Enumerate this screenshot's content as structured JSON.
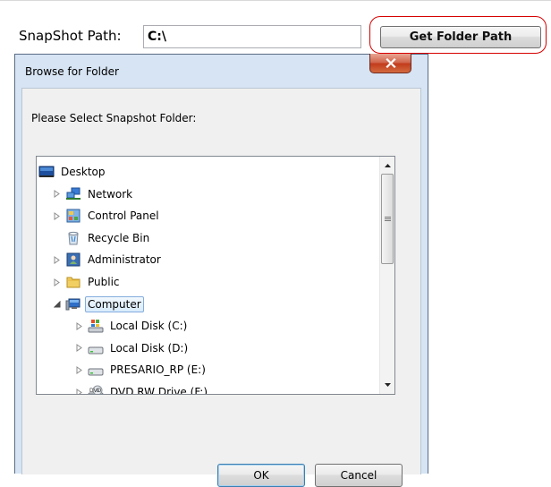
{
  "form": {
    "snapshot_label": "SnapShot Path:",
    "snapshot_value": "C:\\",
    "get_folder_button": "Get Folder Path"
  },
  "dialog": {
    "title": "Browse for Folder",
    "prompt": "Please Select Snapshot Folder:",
    "ok_label": "OK",
    "cancel_label": "Cancel",
    "tree": [
      {
        "label": "Desktop",
        "icon": "desktop-icon",
        "expander": "none"
      },
      {
        "label": "Network",
        "icon": "network-icon",
        "expander": "collapsed"
      },
      {
        "label": "Control Panel",
        "icon": "control-panel-icon",
        "expander": "collapsed"
      },
      {
        "label": "Recycle Bin",
        "icon": "recycle-bin-icon",
        "expander": "none"
      },
      {
        "label": "Administrator",
        "icon": "user-folder-icon",
        "expander": "collapsed"
      },
      {
        "label": "Public",
        "icon": "folder-icon",
        "expander": "collapsed"
      },
      {
        "label": "Computer",
        "icon": "computer-icon",
        "expander": "expanded",
        "selected": true
      },
      {
        "label": "Local Disk (C:)",
        "icon": "system-drive-icon",
        "expander": "collapsed"
      },
      {
        "label": "Local Disk (D:)",
        "icon": "hard-drive-icon",
        "expander": "collapsed"
      },
      {
        "label": "PRESARIO_RP (E:)",
        "icon": "hard-drive-icon",
        "expander": "collapsed"
      },
      {
        "label": "DVD RW Drive (F:)",
        "icon": "dvd-drive-icon",
        "expander": "collapsed"
      }
    ]
  },
  "colors": {
    "highlight_ring": "#d60000",
    "dialog_frame": "#d6e4f3",
    "close_button": "#c13a1c",
    "selection": "#d8ebfb"
  }
}
